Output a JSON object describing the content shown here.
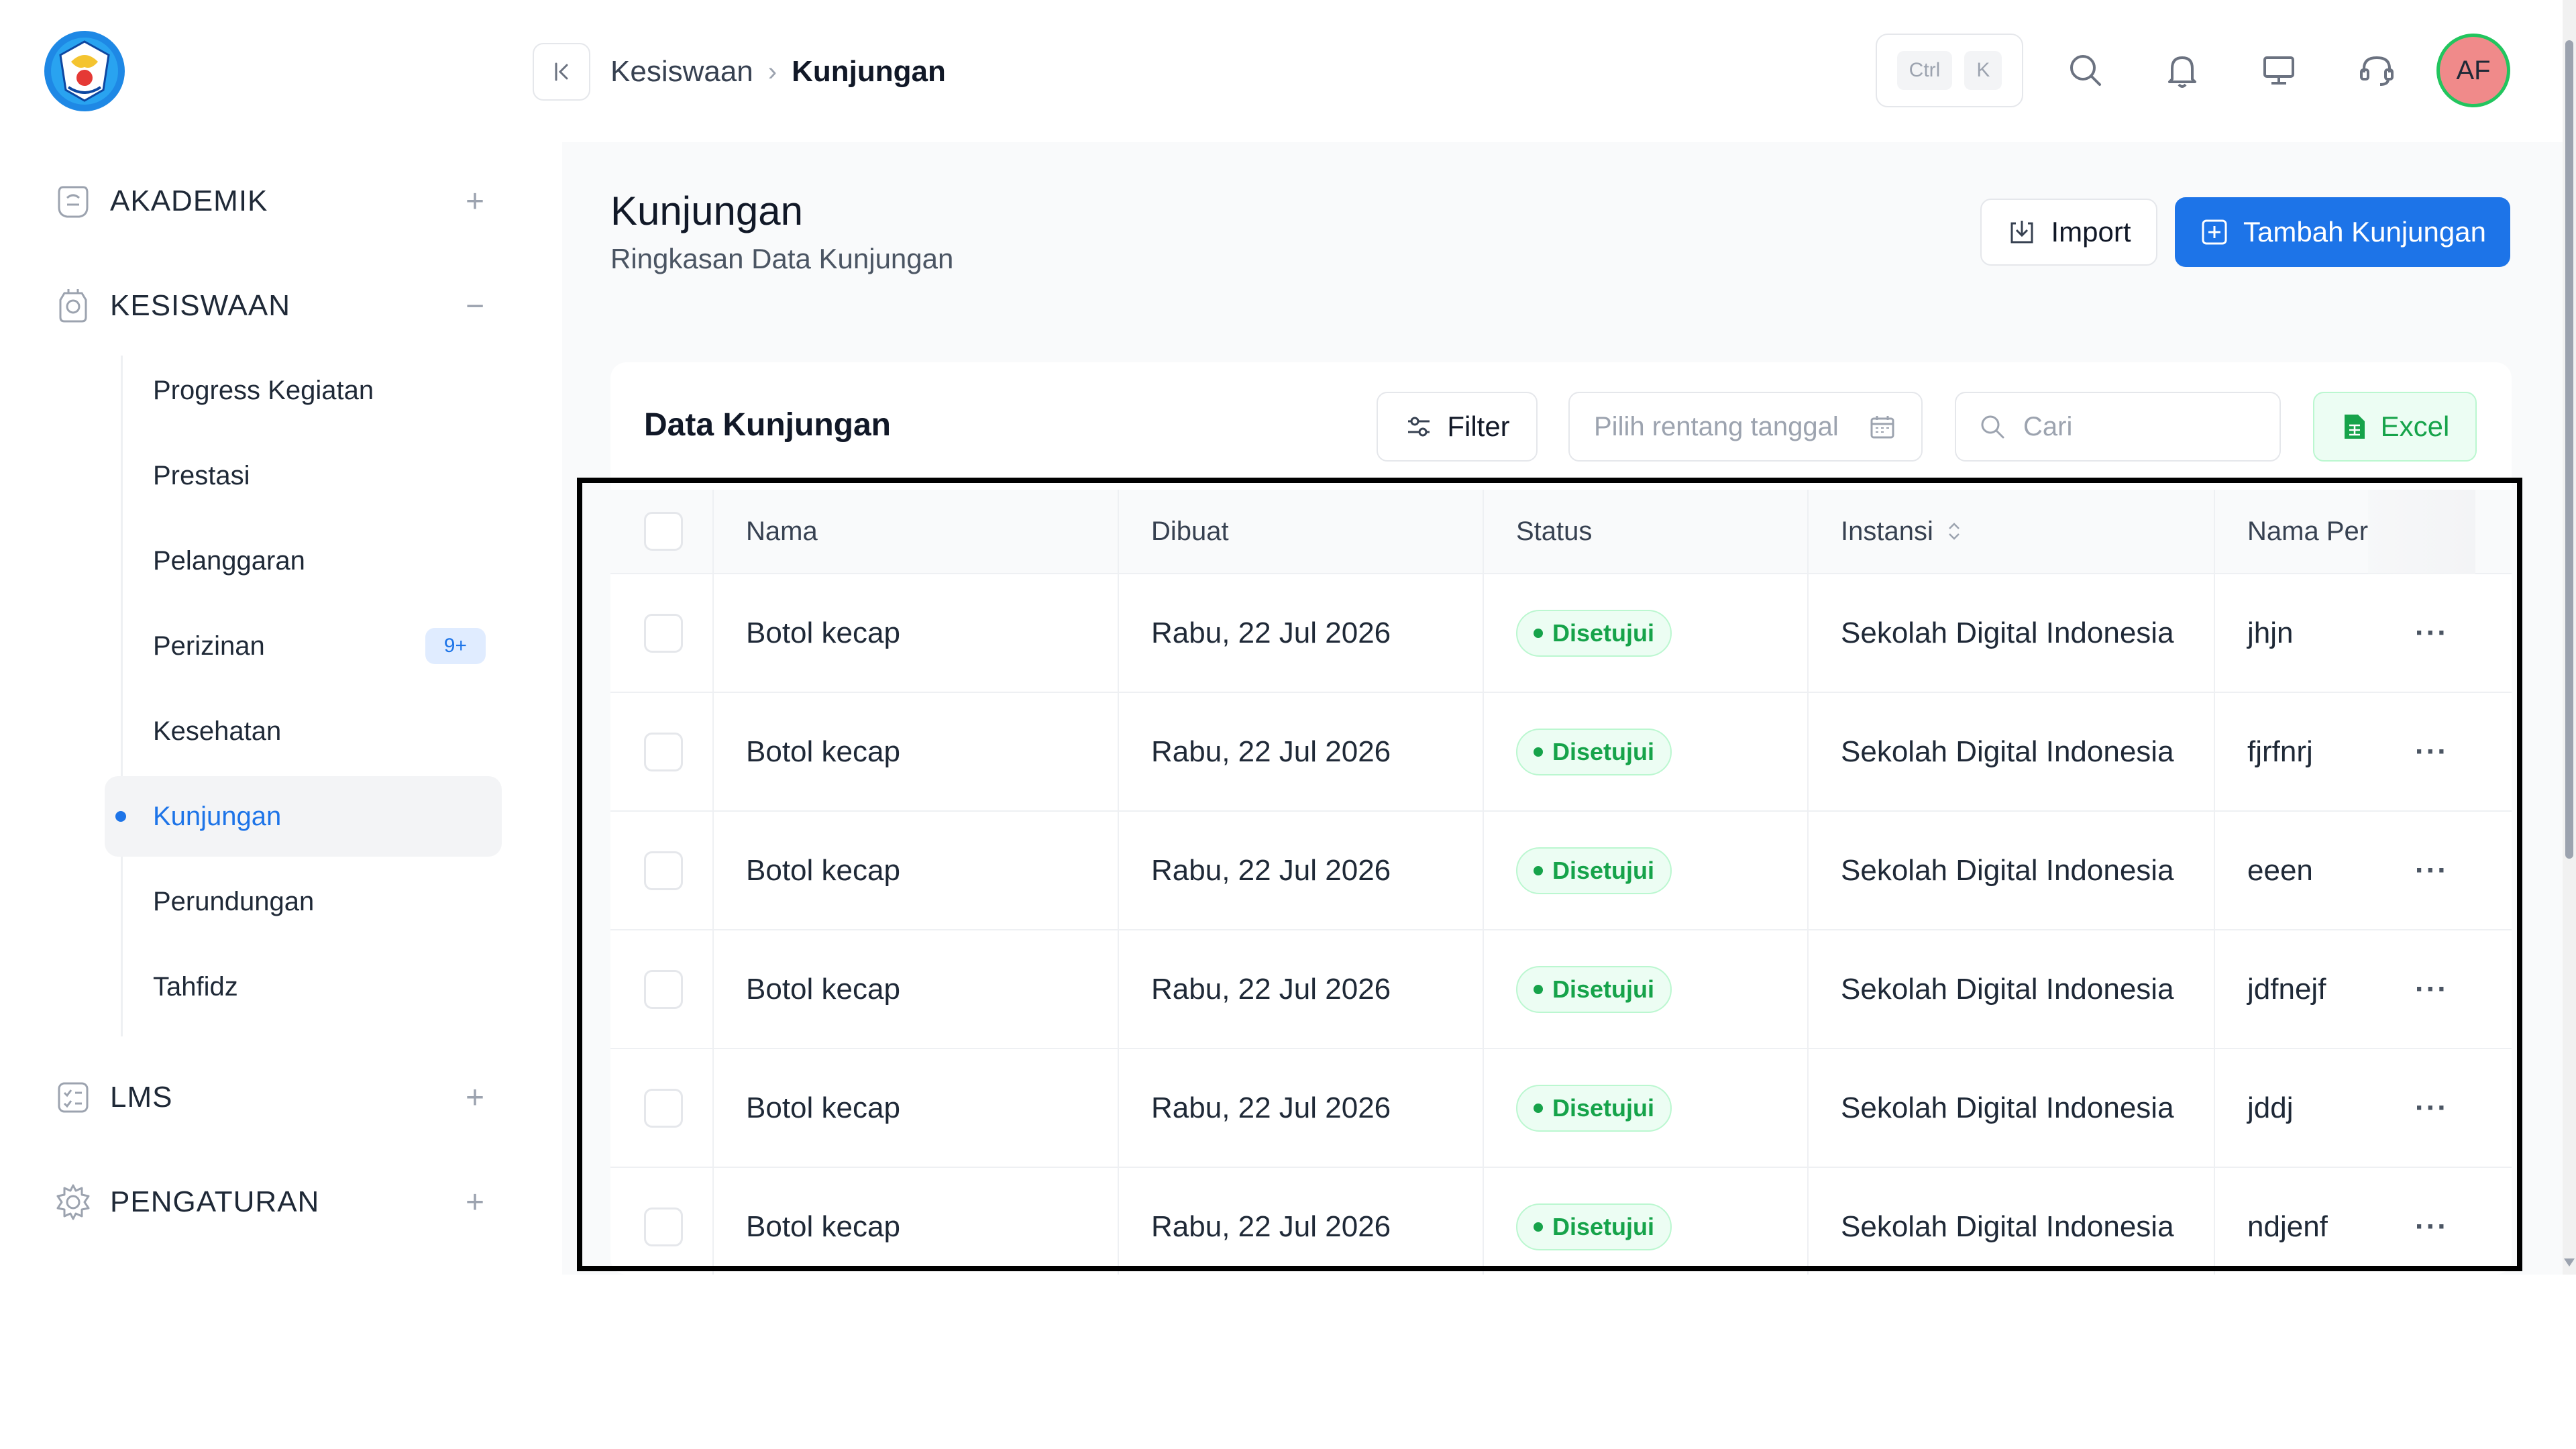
{
  "header": {
    "breadcrumb": [
      "Kesiswaan",
      "Kunjungan"
    ],
    "kbd_keys": [
      "Ctrl",
      "K"
    ],
    "avatar_initials": "AF"
  },
  "sidebar": {
    "groups": [
      {
        "label": "AKADEMIK",
        "toggle": "+"
      },
      {
        "label": "KESISWAAN",
        "toggle": "−"
      },
      {
        "label": "LMS",
        "toggle": "+"
      },
      {
        "label": "PENGATURAN",
        "toggle": "+"
      }
    ],
    "sub_items": [
      {
        "label": "Progress Kegiatan"
      },
      {
        "label": "Prestasi"
      },
      {
        "label": "Pelanggaran"
      },
      {
        "label": "Perizinan",
        "badge": "9+"
      },
      {
        "label": "Kesehatan"
      },
      {
        "label": "Kunjungan",
        "active": true
      },
      {
        "label": "Perundungan"
      },
      {
        "label": "Tahfidz"
      }
    ]
  },
  "page": {
    "title": "Kunjungan",
    "subtitle": "Ringkasan Data Kunjungan",
    "import_label": "Import",
    "add_label": "Tambah Kunjungan"
  },
  "card": {
    "title": "Data Kunjungan",
    "filter_label": "Filter",
    "date_placeholder": "Pilih rentang tanggal",
    "search_placeholder": "Cari",
    "excel_label": "Excel"
  },
  "table": {
    "columns": [
      "Nama",
      "Dibuat",
      "Status",
      "Instansi",
      "Nama Per"
    ],
    "rows": [
      {
        "nama": "Botol kecap",
        "dibuat": "Rabu, 22 Jul 2026",
        "status": "Disetujui",
        "instansi": "Sekolah Digital Indonesia",
        "nama_per": "jhjn"
      },
      {
        "nama": "Botol kecap",
        "dibuat": "Rabu, 22 Jul 2026",
        "status": "Disetujui",
        "instansi": "Sekolah Digital Indonesia",
        "nama_per": "fjrfnrj"
      },
      {
        "nama": "Botol kecap",
        "dibuat": "Rabu, 22 Jul 2026",
        "status": "Disetujui",
        "instansi": "Sekolah Digital Indonesia",
        "nama_per": "eeen"
      },
      {
        "nama": "Botol kecap",
        "dibuat": "Rabu, 22 Jul 2026",
        "status": "Disetujui",
        "instansi": "Sekolah Digital Indonesia",
        "nama_per": "jdfnejf"
      },
      {
        "nama": "Botol kecap",
        "dibuat": "Rabu, 22 Jul 2026",
        "status": "Disetujui",
        "instansi": "Sekolah Digital Indonesia",
        "nama_per": "jddj"
      },
      {
        "nama": "Botol kecap",
        "dibuat": "Rabu, 22 Jul 2026",
        "status": "Disetujui",
        "instansi": "Sekolah Digital Indonesia",
        "nama_per": "ndjenf"
      }
    ],
    "row_menu_label": "···"
  },
  "colors": {
    "accent": "#1d74e8",
    "success": "#16a34a",
    "success_bg": "#ecfdf3",
    "avatar_bg": "#f08a8a",
    "avatar_ring": "#22c55e"
  },
  "icons": {
    "logo": "tut-wuri-handayani-logo",
    "collapse": "collapse-left-icon",
    "search": "search-icon",
    "notification": "bell-icon",
    "monitor": "monitor-icon",
    "support": "headset-icon",
    "import": "import-icon",
    "add": "plus-square-icon",
    "filter": "filter-icon",
    "calendar": "calendar-icon",
    "excel": "spreadsheet-icon"
  }
}
